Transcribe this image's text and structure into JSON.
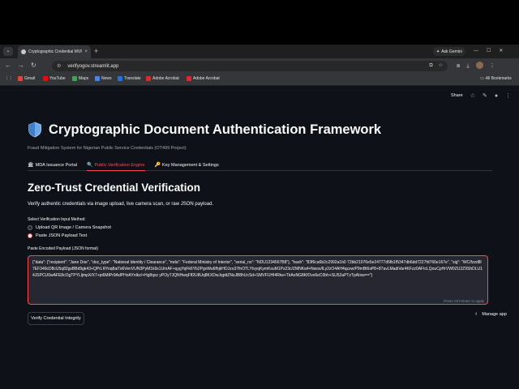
{
  "browser": {
    "tab_title": "Cryptographic Credential MVP",
    "tab_close": "×",
    "new_tab": "+",
    "tab_menu": "⌄",
    "ask_gemini": "Ask Gemini",
    "url": "verifyogov.streamlit.app",
    "bookmarks": [
      "Gmail",
      "YouTube",
      "Maps",
      "News",
      "Translate",
      "Adobe Acrobat",
      "Adobe Acrobat"
    ],
    "all_bookmarks": "All Bookmarks"
  },
  "header": {
    "share": "Share"
  },
  "page": {
    "title": "Cryptographic Document Authentication Framework",
    "subtitle": "Fraud Mitigation System for Nigerian Public Service Credentials (OT499 Project)",
    "tabs": [
      {
        "icon": "🏛",
        "label": "MDA Issuance Portal"
      },
      {
        "icon": "🔍",
        "label": "Public Verification Engine"
      },
      {
        "icon": "🔑",
        "label": "Key Management & Settings"
      }
    ],
    "section_title": "Zero-Trust Credential Verification",
    "section_desc": "Verify authentic credentials via image upload, live camera scan, or raw JSON payload.",
    "radio_label": "Select Verification Input Method:",
    "radio_options": [
      "Upload QR Image / Camera Snapshot",
      "Paste JSON Payload Text"
    ],
    "selected_option": 1,
    "textarea_label": "Paste Encoded Payload (JSON format)",
    "textarea_value": "{\"data\": {\"recipient\": \"Jane Doe\", \"doc_type\": \"National Identity / Clearance\", \"mda\": \"Federal Ministry of Interior\", \"serial_no\": \"NDU1234567B8\"}, \"hash\": \"83f6ca6b2c2992a1b0 72bb21076e5e24777d5fb1f5347db6dd7227fd766e167e\", \"sig\": \"WC/fzzd8l7EF349cD8cU5q82gsBBd9gk43+QPrLRYoq8aiTo6VenVUN3PyM1k9s1UmAF+qygYqFk6Yb2PgvWu6fhjkHOJzo37fnOTLYtvyqKymKsuM1Ps23c/ZMNKwf+Nwox/lLy2zO4AH4qzzw/P9mBt6sP8+87avLMadiVar4KFzz0AFtcLQouCpHrVW0ZU2Z9ShDLU14JSPCU0wAFE8cOgTPYLljmpX/X7+pi6MIPr9AdPHoAYnlkz/+Hg8qsz yPOyTJQNHwqFlf2U8Uq8KXDwJqpttZNsJB8hUcSd+SMVFUHI4Rtw+TkAoNG8KfOvx6eC0bh+SU52aPTzTpAIow==\"}",
    "textarea_hint": "Press Ctrl+Enter to apply",
    "verify_button": "Verify Credential Integrity",
    "manage_app": "Manage app"
  },
  "colors": {
    "accent": "#ff4b4b",
    "app_bg": "#0e1117",
    "input_bg": "#262730"
  }
}
